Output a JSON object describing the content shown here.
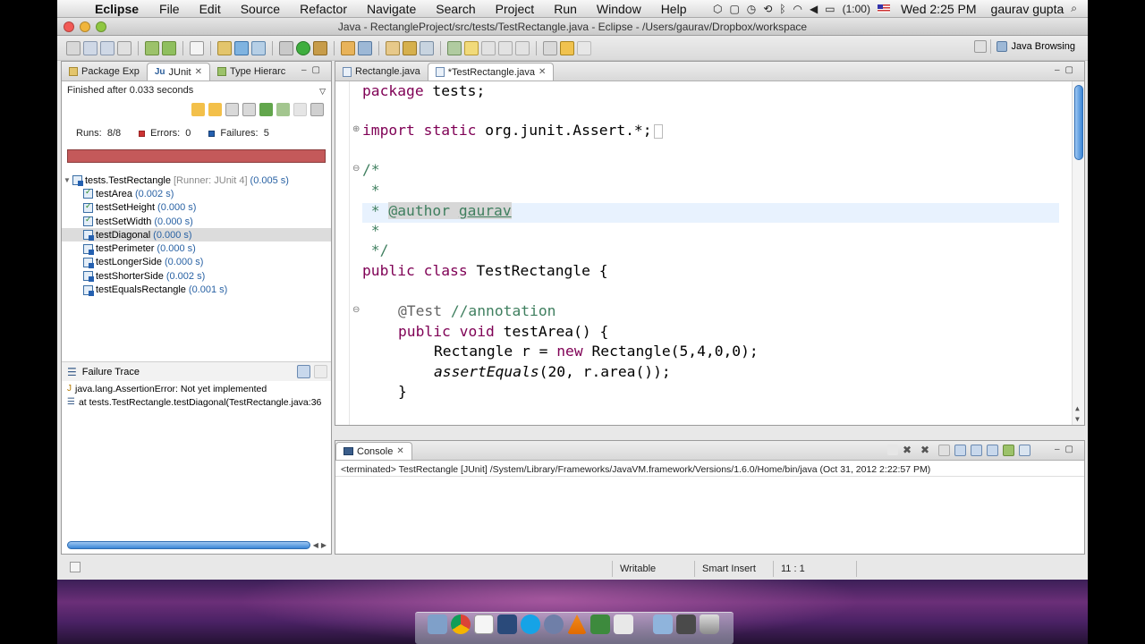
{
  "menubar": {
    "app_name": "Eclipse",
    "items": [
      "File",
      "Edit",
      "Source",
      "Refactor",
      "Navigate",
      "Search",
      "Project",
      "Run",
      "Window",
      "Help"
    ],
    "battery": "(1:00)",
    "clock": "Wed 2:25 PM",
    "user": "gaurav gupta"
  },
  "window": {
    "title": "Java - RectangleProject/src/tests/TestRectangle.java - Eclipse - /Users/gaurav/Dropbox/workspace"
  },
  "perspective": {
    "label": "Java Browsing"
  },
  "left_panel": {
    "tabs": [
      "Package Exp",
      "JUnit",
      "Type Hierarc"
    ],
    "finished_text": "Finished after 0.033 seconds",
    "runs_label": "Runs:",
    "runs_value": "8/8",
    "errors_label": "Errors:",
    "errors_value": "0",
    "failures_label": "Failures:",
    "failures_value": "5",
    "tree_root": {
      "name": "tests.TestRectangle",
      "runner": "[Runner: JUnit 4]",
      "time": "(0.005 s)"
    },
    "tests": [
      {
        "name": "testArea",
        "time": "(0.002 s)",
        "status": "ok"
      },
      {
        "name": "testSetHeight",
        "time": "(0.000 s)",
        "status": "ok"
      },
      {
        "name": "testSetWidth",
        "time": "(0.000 s)",
        "status": "ok"
      },
      {
        "name": "testDiagonal",
        "time": "(0.000 s)",
        "status": "fail"
      },
      {
        "name": "testPerimeter",
        "time": "(0.000 s)",
        "status": "fail"
      },
      {
        "name": "testLongerSide",
        "time": "(0.000 s)",
        "status": "fail"
      },
      {
        "name": "testShorterSide",
        "time": "(0.002 s)",
        "status": "fail"
      },
      {
        "name": "testEqualsRectangle",
        "time": "(0.001 s)",
        "status": "fail"
      }
    ],
    "failure_trace_title": "Failure Trace",
    "trace_lines": [
      "java.lang.AssertionError: Not yet implemented",
      "at tests.TestRectangle.testDiagonal(TestRectangle.java:36"
    ]
  },
  "editor": {
    "tabs": [
      "Rectangle.java",
      "*TestRectangle.java"
    ],
    "code": {
      "l1": "package tests;",
      "l2_kw1": "import",
      "l2_kw2": "static",
      "l2_rest": "org.junit.Assert.*;",
      "l3": "/*",
      "l4": " *",
      "l5": " * @author gaurav",
      "l6": " *",
      "l7": " */",
      "l8_kw1": "public",
      "l8_kw2": "class",
      "l8_rest": "TestRectangle {",
      "l9_ann": "@Test",
      "l9_cm": "//annotation",
      "l10_kw1": "public",
      "l10_kw2": "void",
      "l10_rest": "testArea() {",
      "l11_a": "Rectangle r = ",
      "l11_kw": "new",
      "l11_b": " Rectangle(5,4,0,0);",
      "l12_it": "assertEquals",
      "l12_rest": "(20, r.area());",
      "l13": "}"
    }
  },
  "console": {
    "tab": "Console",
    "path": "<terminated> TestRectangle [JUnit] /System/Library/Frameworks/JavaVM.framework/Versions/1.6.0/Home/bin/java (Oct 31, 2012 2:22:57 PM)"
  },
  "statusbar": {
    "writable": "Writable",
    "insert_mode": "Smart Insert",
    "position": "11 : 1"
  },
  "colors": {
    "progress_fail": "#c4595a",
    "keyword": "#7f0055",
    "comment": "#3f7f5f",
    "javadoc": "#3f5fbf"
  }
}
